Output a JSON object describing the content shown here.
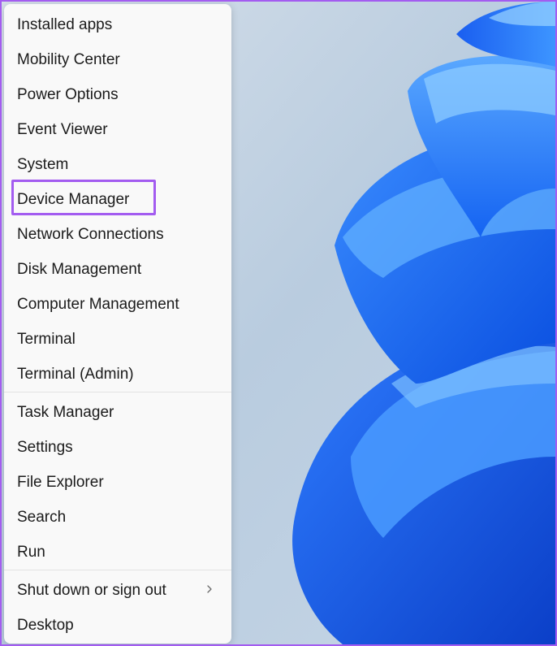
{
  "menu": {
    "items": [
      {
        "label": "Installed apps"
      },
      {
        "label": "Mobility Center"
      },
      {
        "label": "Power Options"
      },
      {
        "label": "Event Viewer"
      },
      {
        "label": "System"
      },
      {
        "label": "Device Manager"
      },
      {
        "label": "Network Connections"
      },
      {
        "label": "Disk Management"
      },
      {
        "label": "Computer Management"
      },
      {
        "label": "Terminal"
      },
      {
        "label": "Terminal (Admin)"
      },
      {
        "label": "Task Manager"
      },
      {
        "label": "Settings"
      },
      {
        "label": "File Explorer"
      },
      {
        "label": "Search"
      },
      {
        "label": "Run"
      },
      {
        "label": "Shut down or sign out",
        "submenu_icon": "chevron-right-icon"
      },
      {
        "label": "Desktop"
      }
    ],
    "highlighted_item": "Device Manager"
  },
  "colors": {
    "highlight_border": "#a35cf0",
    "menu_background": "#f9f9f9",
    "wallpaper_accent": "#1e6cff"
  }
}
